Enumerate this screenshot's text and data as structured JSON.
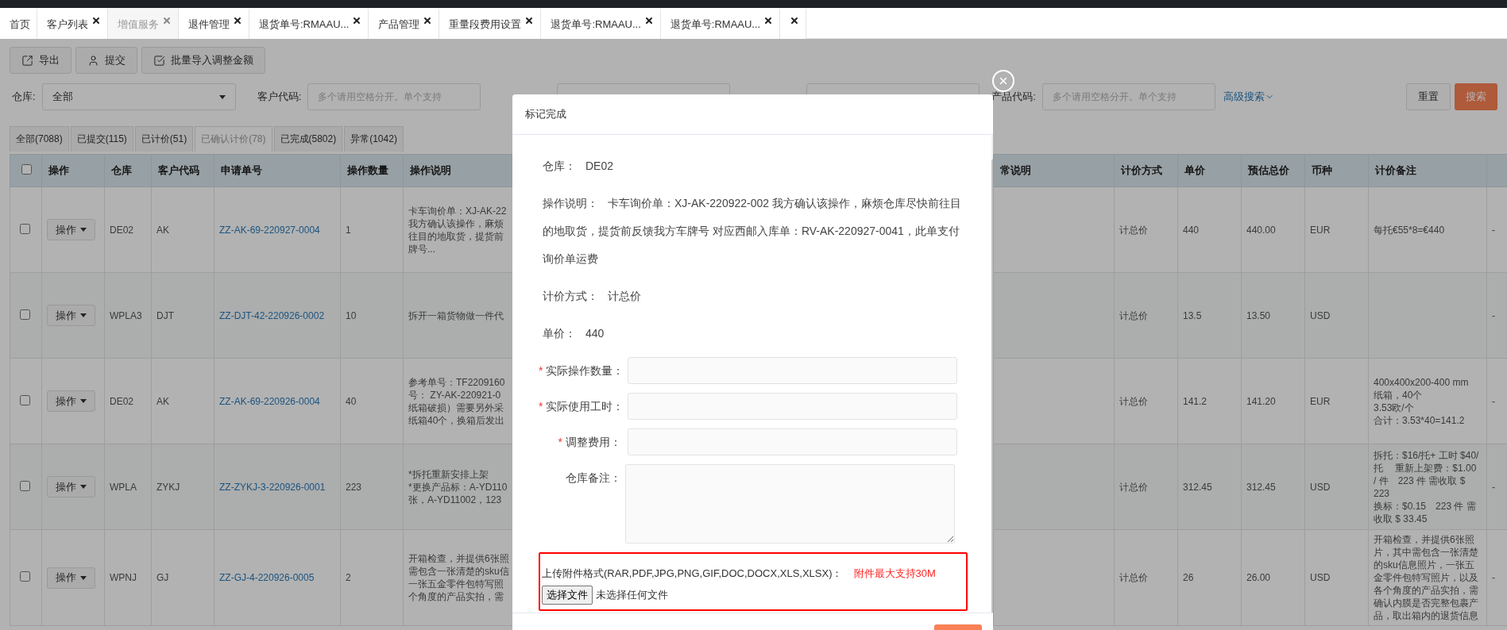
{
  "tabs": [
    {
      "label": "首页",
      "closable": false,
      "selected": false
    },
    {
      "label": "客户列表",
      "closable": true,
      "selected": false
    },
    {
      "label": "增值服务",
      "closable": true,
      "selected": true
    },
    {
      "label": "退件管理",
      "closable": true,
      "selected": false
    },
    {
      "label": "退货单号:RMAAU...",
      "closable": true,
      "selected": false
    },
    {
      "label": "产品管理",
      "closable": true,
      "selected": false
    },
    {
      "label": "重量段费用设置",
      "closable": true,
      "selected": false
    },
    {
      "label": "退货单号:RMAAU...",
      "closable": true,
      "selected": false
    },
    {
      "label": "退货单号:RMAAU...",
      "closable": true,
      "selected": false
    },
    {
      "closable": true,
      "selected": false
    }
  ],
  "toolbar": [
    "导出",
    "提交",
    "批量导入调整金额"
  ],
  "filters": {
    "warehouse": {
      "label": "仓库:",
      "value": "全部"
    },
    "customer_code": {
      "label": "客户代码:",
      "placeholder": "多个请用空格分开。单个支持"
    },
    "product_code": {
      "label": "产品代码:",
      "placeholder": "多个请用空格分开。单个支持"
    },
    "advanced_search": "高级搜索",
    "reset": "重置",
    "search": "搜索"
  },
  "status_tabs": [
    {
      "label": "全部(7088)",
      "selected": false
    },
    {
      "label": "已提交(115)",
      "selected": false
    },
    {
      "label": "已计价(51)",
      "selected": false
    },
    {
      "label": "已确认计价(78)",
      "selected": true
    },
    {
      "label": "已完成(5802)",
      "selected": false
    },
    {
      "label": "异常(1042)",
      "selected": false
    }
  ],
  "table": {
    "select_all_checked": false,
    "columns": [
      "操作",
      "仓库",
      "客户代码",
      "申请单号",
      "操作数量",
      "操作说明",
      "常说明",
      "计价方式",
      "单价",
      "预估总价",
      "币种",
      "计价备注"
    ],
    "rows": [
      {
        "checked": false,
        "action": "操作",
        "warehouse": "DE02",
        "customer_code": "AK",
        "request_no": "ZZ-AK-69-220927-0004",
        "quantity": "1",
        "description": [
          "卡车询价单：XJ-AK-22",
          "我方确认该操作，麻烦",
          "往目的地取货，提货前",
          "牌号..."
        ],
        "pricing_method": "计总价",
        "unit_price": "440",
        "estimated_total": "440.00",
        "currency": "EUR",
        "pricing_note": [
          "每托€55*8=€440"
        ],
        "column_15": "-"
      },
      {
        "checked": false,
        "action": "操作",
        "warehouse": "WPLA3",
        "customer_code": "DJT",
        "request_no": "ZZ-DJT-42-220926-0002",
        "quantity": "10",
        "description": [
          "拆开一箱货物做一件代"
        ],
        "pricing_method": "计总价",
        "unit_price": "13.5",
        "estimated_total": "13.50",
        "currency": "USD",
        "column_15": "-"
      },
      {
        "checked": false,
        "action": "操作",
        "warehouse": "DE02",
        "customer_code": "AK",
        "request_no": "ZZ-AK-69-220926-0004",
        "quantity": "40",
        "description": [
          "参考单号：TF2209160",
          "号： ZY-AK-220921-0",
          "纸箱破损）需要另外采",
          "纸箱40个，换箱后发出"
        ],
        "pricing_method": "计总价",
        "unit_price": "141.2",
        "estimated_total": "141.20",
        "currency": "EUR",
        "pricing_note": [
          "400x400x200-400 mm",
          "纸箱，40个",
          "3.53欧/个",
          "合计：3.53*40=141.2"
        ],
        "column_15": "-"
      },
      {
        "checked": false,
        "action": "操作",
        "warehouse": "WPLA",
        "customer_code": "ZYKJ",
        "request_no": "ZZ-ZYKJ-3-220926-0001",
        "quantity": "223",
        "description": [
          "*拆托重新安排上架",
          "*更换产品标：A-YD110",
          "张，A-YD11002，123"
        ],
        "pricing_method": "计总价",
        "unit_price": "312.45",
        "estimated_total": "312.45",
        "currency": "USD",
        "pricing_note": [
          "拆托：$16/托+ 工时 $40/托　 重新上架费：$1.00 / 件　223 件 需收取 $ 223",
          "换标：$0.15　223 件 需收取 $ 33.45"
        ],
        "column_15": "-"
      },
      {
        "checked": false,
        "action": "操作",
        "warehouse": "WPNJ",
        "customer_code": "GJ",
        "request_no": "ZZ-GJ-4-220926-0005",
        "quantity": "2",
        "description": [
          "开箱检查，并提供6张照",
          "需包含一张清楚的sku信",
          "一张五金零件包特写照",
          "个角度的产品实拍，需"
        ],
        "pricing_method": "计总价",
        "unit_price": "26",
        "estimated_total": "26.00",
        "currency": "USD",
        "pricing_note": [
          "开箱检查，并提供6张照片，其中需包含一张清楚的sku信息照片，一张五金零件包特写照片，以及各个角度的产品实拍，需确认内膜是否完整包裹产品，取出箱内的退货信息"
        ],
        "column_15": "-"
      }
    ]
  },
  "modal": {
    "title": "标记完成",
    "info": [
      {
        "label": "仓库：",
        "value": "DE02"
      },
      {
        "label": "操作说明：",
        "value": "卡车询价单：XJ-AK-220922-002 我方确认该操作，麻烦仓库尽快前往目的地取货，提货前反馈我方车牌号 对应西邮入库单：RV-AK-220927-0041，此单支付询价单运费"
      },
      {
        "label": "计价方式：",
        "value": "计总价"
      },
      {
        "label": "单价：",
        "value": "440"
      }
    ],
    "fields": [
      {
        "required_mark": "*",
        "label": "实际操作数量：",
        "kind": "input"
      },
      {
        "required_mark": "*",
        "label": "实际使用工时：",
        "kind": "input"
      },
      {
        "required_mark": "*",
        "label": "调整费用：",
        "kind": "input"
      },
      {
        "label": "仓库备注：",
        "kind": "textarea"
      }
    ],
    "upload": {
      "formats": "上传附件格式(RAR,PDF,JPG,PNG,GIF,DOC,DOCX,XLS,XLSX)：",
      "limit": "附件最大支持30M",
      "button": "选择文件",
      "status": "未选择任何文件"
    }
  }
}
